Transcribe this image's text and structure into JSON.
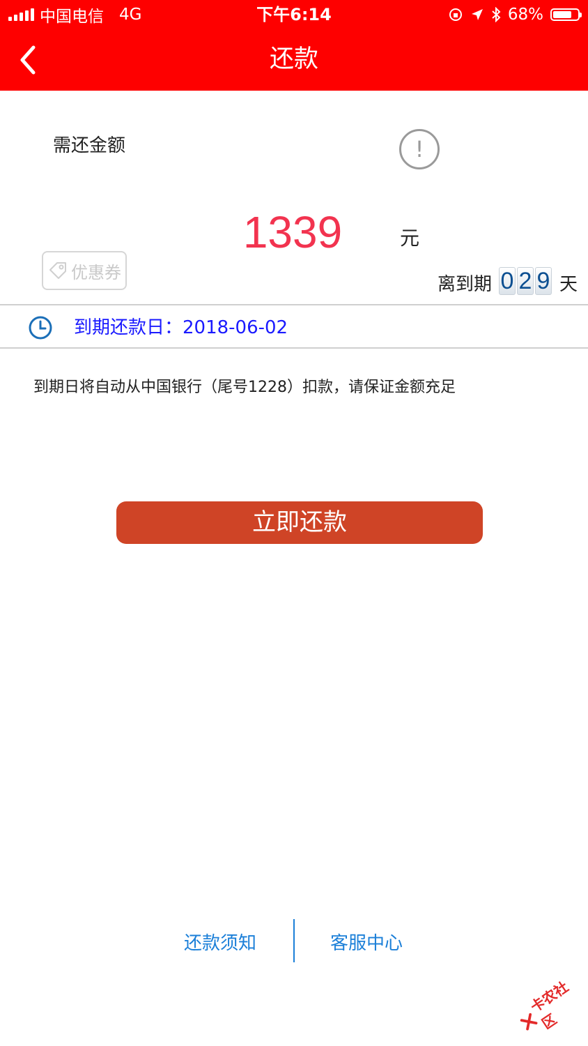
{
  "status_bar": {
    "carrier": "中国电信",
    "network": "4G",
    "time": "下午6:14",
    "battery": "68%",
    "battery_level": 0.68
  },
  "nav": {
    "title": "还款"
  },
  "amount": {
    "label": "需还金额",
    "value": "1339",
    "unit": "元"
  },
  "coupon": {
    "label": "优惠券"
  },
  "due": {
    "label": "离到期",
    "digits": [
      "0",
      "2",
      "9"
    ],
    "unit": "天",
    "date_label": "到期还款日：2018-06-02"
  },
  "notice": {
    "text": "到期日将自动从中国银行（尾号1228）扣款，请保证金额充足"
  },
  "actions": {
    "repay_label": "立即还款"
  },
  "footer": {
    "notice_link": "还款须知",
    "service_link": "客服中心"
  },
  "watermark": {
    "text": "卡农社区"
  },
  "colors": {
    "header": "#fe0000",
    "amount": "#f2334f",
    "button": "#cf4426",
    "link": "#1b7fd8",
    "date_text": "#1a1aff"
  }
}
